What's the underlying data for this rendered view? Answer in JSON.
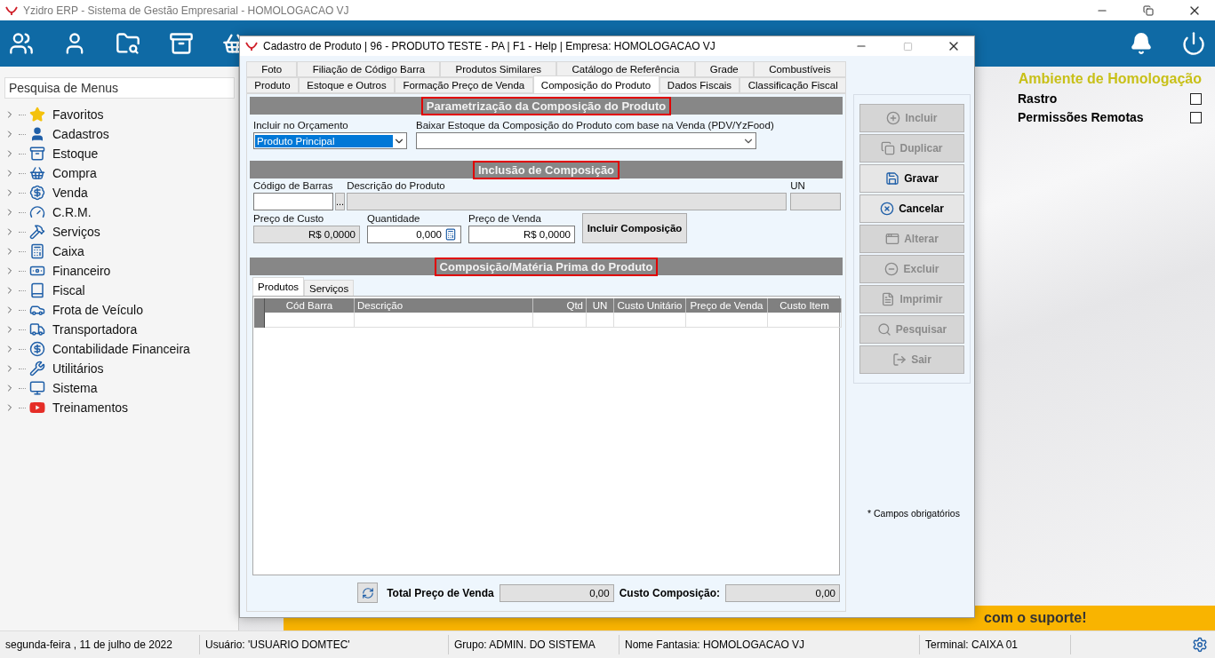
{
  "app_window": {
    "title": "Yzidro ERP - Sistema de Gestão Empresarial - HOMOLOGACAO VJ"
  },
  "menu_search": {
    "placeholder": "Pesquisa de Menus"
  },
  "menu_tree": [
    {
      "label": "Favoritos",
      "expanded": false
    },
    {
      "label": "Cadastros",
      "expanded": false
    },
    {
      "label": "Estoque",
      "expanded": false
    },
    {
      "label": "Compra",
      "expanded": false
    },
    {
      "label": "Venda",
      "expanded": false
    },
    {
      "label": "C.R.M.",
      "expanded": false
    },
    {
      "label": "Serviços",
      "expanded": false
    },
    {
      "label": "Caixa",
      "expanded": false
    },
    {
      "label": "Financeiro",
      "expanded": false
    },
    {
      "label": "Fiscal",
      "expanded": false
    },
    {
      "label": "Frota de Veículo",
      "expanded": false
    },
    {
      "label": "Transportadora",
      "expanded": false
    },
    {
      "label": "Contabilidade Financeira",
      "expanded": false
    },
    {
      "label": "Utilitários",
      "expanded": false
    },
    {
      "label": "Sistema",
      "expanded": false
    },
    {
      "label": "Treinamentos",
      "expanded": false
    }
  ],
  "environment": {
    "title": "Ambiente de Homologação",
    "options": [
      {
        "label": "Rastro",
        "checked": false
      },
      {
        "label": "Permissões Remotas",
        "checked": false
      }
    ]
  },
  "banner": "com o suporte!",
  "status_bar": [
    "segunda-feira , 11 de julho de 2022",
    "Usuário: 'USUARIO DOMTEC'",
    "Grupo: ADMIN. DO SISTEMA",
    "Nome Fantasia: HOMOLOGACAO VJ",
    "Terminal: CAIXA 01"
  ],
  "dialog": {
    "title": "Cadastro de Produto  | 96 - PRODUTO TESTE - PA | F1 - Help | Empresa: HOMOLOGACAO VJ",
    "tab_rows": [
      [
        {
          "label": "Foto",
          "selected": false
        },
        {
          "label": "Filiação de Código Barra",
          "selected": false
        },
        {
          "label": "Produtos Similares",
          "selected": false
        },
        {
          "label": "Catálogo de Referência",
          "selected": false
        },
        {
          "label": "Grade",
          "selected": false
        },
        {
          "label": "Combustíveis",
          "selected": false
        }
      ],
      [
        {
          "label": "Produto",
          "selected": false
        },
        {
          "label": "Estoque e Outros",
          "selected": false
        },
        {
          "label": "Formação Preço de Venda",
          "selected": false
        },
        {
          "label": "Composição do Produto",
          "selected": true
        },
        {
          "label": "Dados Fiscais",
          "selected": false
        },
        {
          "label": "Classificação Fiscal",
          "selected": false
        }
      ]
    ],
    "parametrization": {
      "title": "Parametrização da Composição do Produto",
      "highlighted": true,
      "include_in_quote": {
        "label": "Incluir no Orçamento",
        "value": "Produto Principal"
      },
      "stock_write_off": {
        "label": "Baixar Estoque da Composição do Produto com base na Venda (PDV/YzFood)"
      }
    },
    "inclusion": {
      "title": "Inclusão de Composição",
      "highlighted": true,
      "barcode": {
        "label": "Código de Barras",
        "disabled": false
      },
      "lookup_button": "...",
      "description": {
        "label": "Descrição do Produto",
        "disabled": true
      },
      "unit": {
        "label": "UN",
        "disabled": true
      },
      "cost_price": {
        "label": "Preço de Custo",
        "value": "R$ 0,0000",
        "disabled": true
      },
      "quantity": {
        "label": "Quantidade",
        "value": "0,000",
        "disabled": false
      },
      "sale_price": {
        "label": "Preço de Venda",
        "value": "R$ 0,0000",
        "disabled": false
      },
      "include_button": "Incluir Composição"
    },
    "composition": {
      "title": "Composição/Matéria Prima do Produto",
      "highlighted": true,
      "tabs": [
        {
          "label": "Produtos",
          "selected": true
        },
        {
          "label": "Serviços",
          "selected": false
        }
      ],
      "table": {
        "columns": [
          "Cód Barra",
          "Descrição",
          "Qtd",
          "UN",
          "Custo Unitário",
          "Preço de Venda",
          "Custo Item"
        ]
      }
    },
    "totals": {
      "sale_label": "Total Preço de Venda",
      "sale_value": "0,00",
      "cost_label": "Custo Composição:",
      "cost_value": "0,00"
    },
    "actions": [
      {
        "label": "Incluir",
        "disabled": true
      },
      {
        "label": "Duplicar",
        "disabled": true
      },
      {
        "label": "Gravar",
        "disabled": false
      },
      {
        "label": "Cancelar",
        "disabled": false
      },
      {
        "label": "Alterar",
        "disabled": true
      },
      {
        "label": "Excluir",
        "disabled": true
      },
      {
        "label": "Imprimir",
        "disabled": true
      },
      {
        "label": "Pesquisar",
        "disabled": true
      },
      {
        "label": "Sair",
        "disabled": true
      }
    ],
    "required_note": "* Campos obrigatórios"
  }
}
